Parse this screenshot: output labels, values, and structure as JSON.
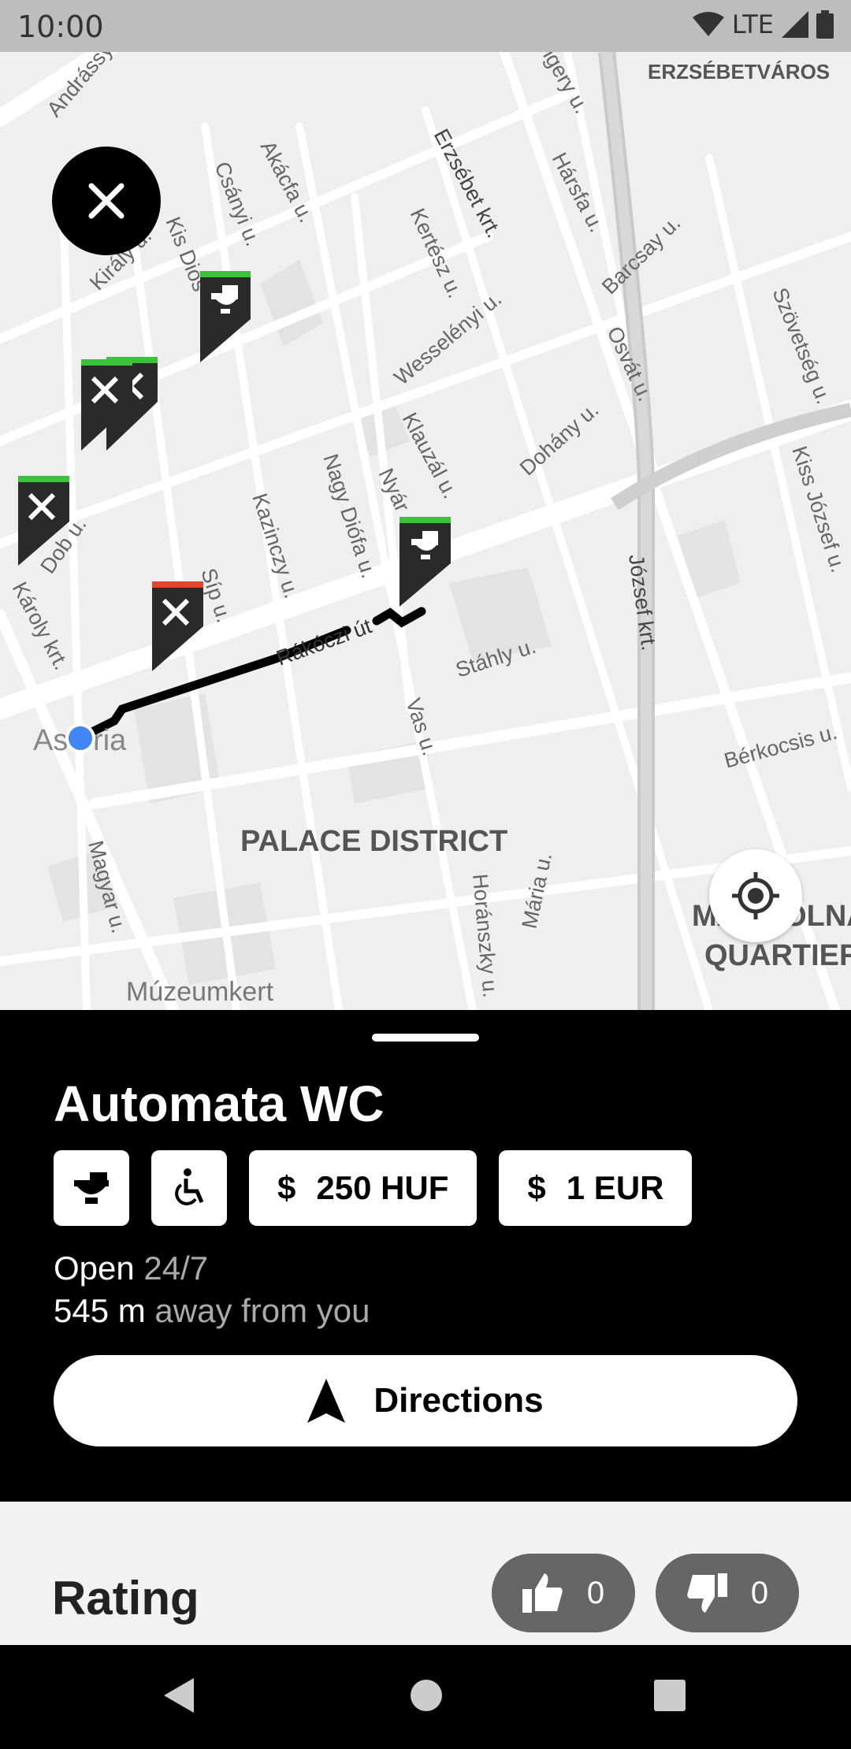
{
  "status_bar": {
    "time": "10:00",
    "network": "LTE"
  },
  "map": {
    "district_labels": [
      "ERZSÉBETVÁROS",
      "PALACE DISTRICT",
      "MAGDOLNA",
      "QUARTIER"
    ],
    "streets": {
      "andrassy": "Andrássy út",
      "csengery": "Csengery u.",
      "erzsebet": "Erzsébet krt.",
      "harsfa": "Hársfa u.",
      "akacfa": "Akácfa u.",
      "csanyi": "Csányi u.",
      "kis_diof": "Kis Diós",
      "kiraly": "Király u.",
      "kertesz": "Kertész u.",
      "barcsay": "Barcsay u.",
      "szovetseg": "Szövetség u.",
      "wesselenyi": "Wesselényi u.",
      "osvat": "Osvát u.",
      "klauzal": "Klauzál u.",
      "dohany": "Dohány u.",
      "kiss_jozsef": "Kiss József u.",
      "nagy_diofa": "Nagy Diófa u.",
      "nyar": "Nyár",
      "kazinczy": "Kazinczy u.",
      "dob": "Dob u.",
      "sip": "Síp u.",
      "karoly": "Károly krt.",
      "rakoczi": "Rákóczi út",
      "jozsef": "József krt.",
      "stahly": "Stáhly u.",
      "vas": "Vas u.",
      "berkocsis": "Bérkocsis u.",
      "astoria": "Astoria",
      "magyar": "Magyar u.",
      "horanszky": "Horánszky u.",
      "maria": "Mária u.",
      "muzeumkert": "Múzeumkert"
    }
  },
  "place": {
    "name": "Automata WC",
    "features": [
      "toilet-icon",
      "wheelchair-icon"
    ],
    "prices": [
      {
        "symbol": "$",
        "label": "250 HUF"
      },
      {
        "symbol": "$",
        "label": "1 EUR"
      }
    ],
    "open_label": "Open",
    "open_value": "24/7",
    "distance_value": "545 m",
    "distance_suffix": "away from you",
    "directions_label": "Directions"
  },
  "rating": {
    "label": "Rating",
    "thumbs_up": "0",
    "thumbs_down": "0"
  },
  "colors": {
    "accent_green": "#3cc13b",
    "accent_red": "#e2452b",
    "location_blue": "#4285f4"
  }
}
